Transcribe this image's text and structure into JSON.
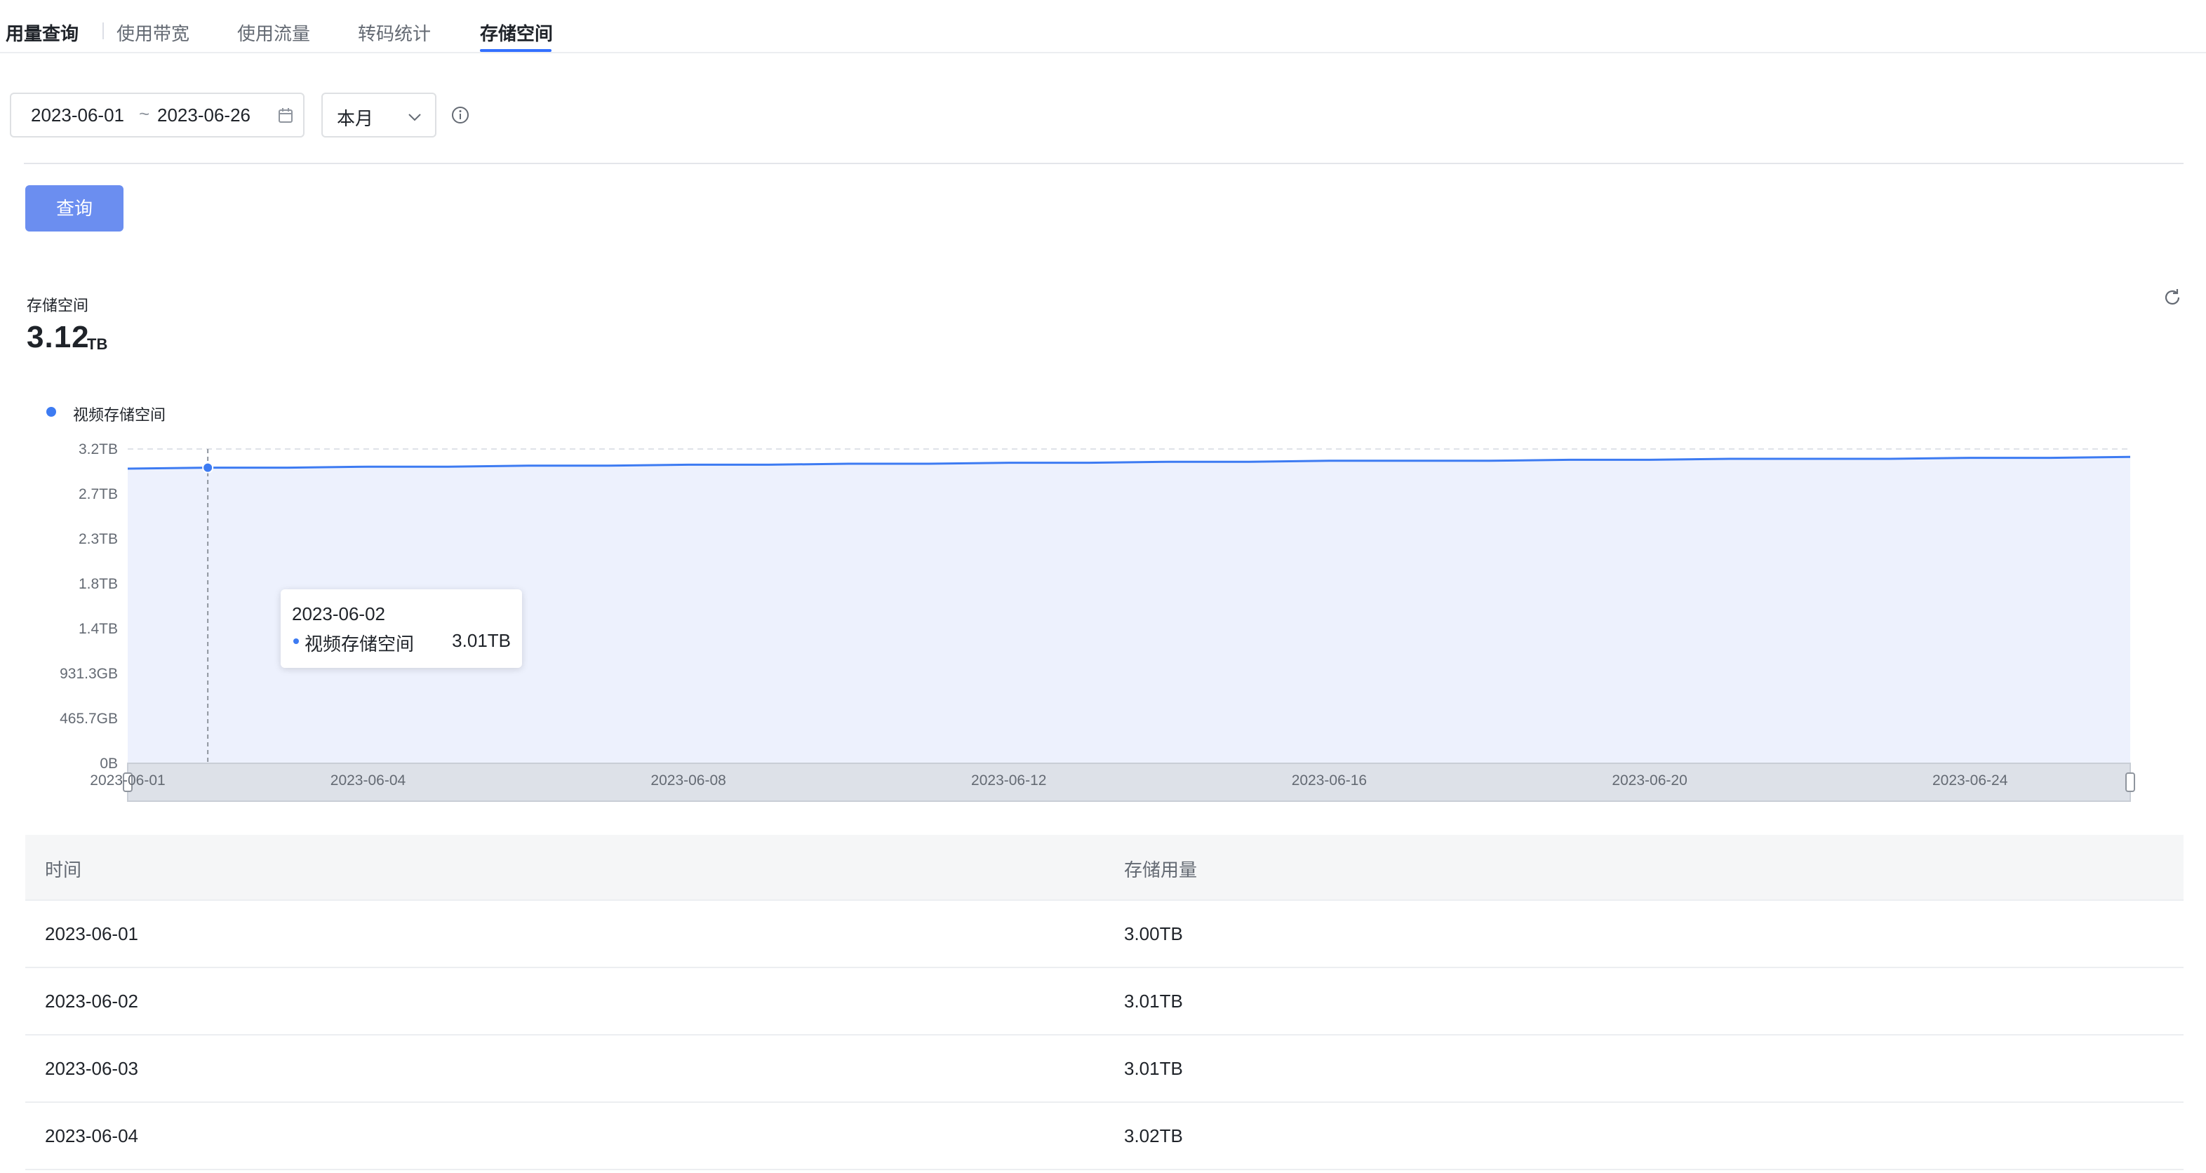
{
  "tabs": {
    "title": "用量查询",
    "items": [
      {
        "label": "使用带宽",
        "active": false
      },
      {
        "label": "使用流量",
        "active": false
      },
      {
        "label": "转码统计",
        "active": false
      },
      {
        "label": "存储空间",
        "active": true
      }
    ]
  },
  "filters": {
    "date_start": "2023-06-01",
    "date_separator": "~",
    "date_end": "2023-06-26",
    "period_selected": "本月",
    "query_button": "查询"
  },
  "summary": {
    "label": "存储空间",
    "value": "3.12",
    "unit": "TB"
  },
  "chart_data": {
    "type": "area",
    "legend": [
      {
        "name": "视频存储空间",
        "color": "#3d7bf2"
      }
    ],
    "y_tick_labels": [
      "3.2TB",
      "2.7TB",
      "2.3TB",
      "1.8TB",
      "1.4TB",
      "931.3GB",
      "465.7GB",
      "0B"
    ],
    "x_tick_labels": [
      "2023-06-01",
      "2023-06-04",
      "2023-06-08",
      "2023-06-12",
      "2023-06-16",
      "2023-06-20",
      "2023-06-24"
    ],
    "ylim_tb": [
      0,
      3.2
    ],
    "x": [
      "2023-06-01",
      "2023-06-02",
      "2023-06-03",
      "2023-06-04",
      "2023-06-05",
      "2023-06-06",
      "2023-06-07",
      "2023-06-08",
      "2023-06-09",
      "2023-06-10",
      "2023-06-11",
      "2023-06-12",
      "2023-06-13",
      "2023-06-14",
      "2023-06-15",
      "2023-06-16",
      "2023-06-17",
      "2023-06-18",
      "2023-06-19",
      "2023-06-20",
      "2023-06-21",
      "2023-06-22",
      "2023-06-23",
      "2023-06-24",
      "2023-06-25",
      "2023-06-26"
    ],
    "series": [
      {
        "name": "视频存储空间",
        "unit": "TB",
        "values": [
          3.0,
          3.01,
          3.01,
          3.02,
          3.02,
          3.03,
          3.03,
          3.04,
          3.04,
          3.05,
          3.05,
          3.06,
          3.06,
          3.07,
          3.07,
          3.08,
          3.08,
          3.08,
          3.09,
          3.09,
          3.1,
          3.1,
          3.1,
          3.11,
          3.11,
          3.12
        ]
      }
    ],
    "grid": true,
    "highlight_index": 1,
    "colors": {
      "line": "#3d7bf2",
      "area": "#edf1fd",
      "grid": "#dfe2e8",
      "dataZoom": "#dde1e8"
    }
  },
  "tooltip": {
    "date": "2023-06-02",
    "series_name": "视频存储空间",
    "value": "3.01TB"
  },
  "table": {
    "columns": [
      "时间",
      "存储用量"
    ],
    "rows": [
      {
        "time": "2023-06-01",
        "usage": "3.00TB"
      },
      {
        "time": "2023-06-02",
        "usage": "3.01TB"
      },
      {
        "time": "2023-06-03",
        "usage": "3.01TB"
      },
      {
        "time": "2023-06-04",
        "usage": "3.02TB"
      }
    ]
  },
  "icons": {
    "calendar": "calendar-icon",
    "chevron": "chevron-down-icon",
    "info": "info-icon",
    "refresh": "refresh-icon"
  }
}
